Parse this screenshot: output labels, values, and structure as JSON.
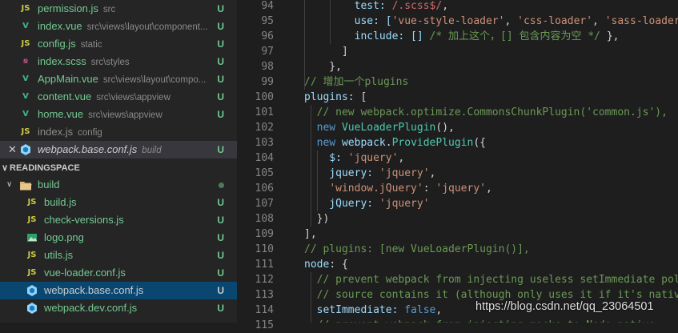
{
  "explorer": {
    "open_editors": [
      {
        "icon": "js",
        "name": "permission.js",
        "path": "src",
        "badge": "U"
      },
      {
        "icon": "vue",
        "name": "index.vue",
        "path": "src\\views\\layout\\component...",
        "badge": "U"
      },
      {
        "icon": "js",
        "name": "config.js",
        "path": "static",
        "badge": "U"
      },
      {
        "icon": "scss",
        "name": "index.scss",
        "path": "src\\styles",
        "badge": "U"
      },
      {
        "icon": "vue",
        "name": "AppMain.vue",
        "path": "src\\views\\layout\\compo...",
        "badge": "U"
      },
      {
        "icon": "vue",
        "name": "content.vue",
        "path": "src\\views\\appview",
        "badge": "U"
      },
      {
        "icon": "vue",
        "name": "home.vue",
        "path": "src\\views\\appview",
        "badge": "U"
      },
      {
        "icon": "js",
        "name": "index.js",
        "path": "config",
        "badge": ""
      },
      {
        "icon": "webpack",
        "name": "webpack.base.conf.js",
        "path": "build",
        "badge": "U"
      }
    ],
    "close_glyph": "✕",
    "section_chevron": "∨",
    "section_title": "READINGSPACE",
    "folder_chevron": "∨",
    "folder_name": "build",
    "files": [
      {
        "icon": "js",
        "name": "build.js",
        "badge": "U"
      },
      {
        "icon": "js",
        "name": "check-versions.js",
        "badge": "U"
      },
      {
        "icon": "img",
        "name": "logo.png",
        "badge": "U"
      },
      {
        "icon": "js",
        "name": "utils.js",
        "badge": "U"
      },
      {
        "icon": "js",
        "name": "vue-loader.conf.js",
        "badge": "U"
      },
      {
        "icon": "webpack",
        "name": "webpack.base.conf.js",
        "badge": "U"
      },
      {
        "icon": "webpack",
        "name": "webpack.dev.conf.js",
        "badge": "U"
      }
    ]
  },
  "editor": {
    "line_numbers": [
      "94",
      "95",
      "96",
      "97",
      "98",
      "99",
      "100",
      "101",
      "102",
      "103",
      "104",
      "105",
      "106",
      "107",
      "108",
      "109",
      "110",
      "111",
      "112",
      "113",
      "114",
      "115"
    ],
    "lines": [
      [
        {
          "t": "        test: ",
          "c": "#9cdcfe"
        },
        {
          "t": "/.scss$/",
          "c": "#d16969"
        },
        {
          "t": ",",
          "c": "#d4d4d4"
        }
      ],
      [
        {
          "t": "        use: [",
          "c": "#9cdcfe"
        },
        {
          "t": "'vue-style-loader'",
          "c": "#ce9178"
        },
        {
          "t": ", ",
          "c": "#d4d4d4"
        },
        {
          "t": "'css-loader'",
          "c": "#ce9178"
        },
        {
          "t": ", ",
          "c": "#d4d4d4"
        },
        {
          "t": "'sass-loader'",
          "c": "#ce9178"
        },
        {
          "t": "],",
          "c": "#d4d4d4"
        }
      ],
      [
        {
          "t": "        include: [] ",
          "c": "#9cdcfe"
        },
        {
          "t": "/* 加上这个，[] 包含内容为空 */",
          "c": "#6a9955"
        },
        {
          "t": " },",
          "c": "#d4d4d4"
        }
      ],
      [
        {
          "t": "      ]",
          "c": "#d4d4d4"
        }
      ],
      [
        {
          "t": "    },",
          "c": "#d4d4d4"
        }
      ],
      [
        {
          "t": "// 增加一个plugins",
          "c": "#6a9955"
        }
      ],
      [
        {
          "t": "plugins",
          "c": "#9cdcfe"
        },
        {
          "t": ": [",
          "c": "#d4d4d4"
        }
      ],
      [
        {
          "t": "  // new webpack.optimize.CommonsChunkPlugin('common.js'),",
          "c": "#6a9955"
        }
      ],
      [
        {
          "t": "  ",
          "c": "#d4d4d4"
        },
        {
          "t": "new ",
          "c": "#569cd6"
        },
        {
          "t": "VueLoaderPlugin",
          "c": "#4ec9b0"
        },
        {
          "t": "(),",
          "c": "#d4d4d4"
        }
      ],
      [
        {
          "t": "  ",
          "c": "#d4d4d4"
        },
        {
          "t": "new ",
          "c": "#569cd6"
        },
        {
          "t": "webpack",
          "c": "#9cdcfe"
        },
        {
          "t": ".",
          "c": "#d4d4d4"
        },
        {
          "t": "ProvidePlugin",
          "c": "#4ec9b0"
        },
        {
          "t": "({",
          "c": "#d4d4d4"
        }
      ],
      [
        {
          "t": "    $: ",
          "c": "#9cdcfe"
        },
        {
          "t": "'jquery'",
          "c": "#ce9178"
        },
        {
          "t": ",",
          "c": "#d4d4d4"
        }
      ],
      [
        {
          "t": "    jquery: ",
          "c": "#9cdcfe"
        },
        {
          "t": "'jquery'",
          "c": "#ce9178"
        },
        {
          "t": ",",
          "c": "#d4d4d4"
        }
      ],
      [
        {
          "t": "    ",
          "c": "#d4d4d4"
        },
        {
          "t": "'window.jQuery'",
          "c": "#ce9178"
        },
        {
          "t": ": ",
          "c": "#d4d4d4"
        },
        {
          "t": "'jquery'",
          "c": "#ce9178"
        },
        {
          "t": ",",
          "c": "#d4d4d4"
        }
      ],
      [
        {
          "t": "    jQuery: ",
          "c": "#9cdcfe"
        },
        {
          "t": "'jquery'",
          "c": "#ce9178"
        }
      ],
      [
        {
          "t": "  })",
          "c": "#d4d4d4"
        }
      ],
      [
        {
          "t": "],",
          "c": "#d4d4d4"
        }
      ],
      [
        {
          "t": "// plugins: [new VueLoaderPlugin()],",
          "c": "#6a9955"
        }
      ],
      [
        {
          "t": "node",
          "c": "#9cdcfe"
        },
        {
          "t": ": {",
          "c": "#d4d4d4"
        }
      ],
      [
        {
          "t": "  // prevent webpack from injecting useless setImmediate poly",
          "c": "#6a9955"
        }
      ],
      [
        {
          "t": "  // source contains it (although only uses it if it's native",
          "c": "#6a9955"
        }
      ],
      [
        {
          "t": "  setImmediate: ",
          "c": "#9cdcfe"
        },
        {
          "t": "false",
          "c": "#569cd6"
        },
        {
          "t": ",",
          "c": "#d4d4d4"
        }
      ],
      [
        {
          "t": "  // prevent webpack from injecting mocks to Node native",
          "c": "#6a9955"
        }
      ]
    ]
  },
  "watermark": "https://blog.csdn.net/qq_23064501"
}
